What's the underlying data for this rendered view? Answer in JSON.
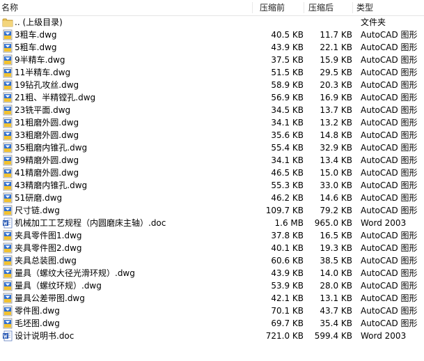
{
  "columns": {
    "name": "名称",
    "compressed": "压缩前",
    "original": "压缩后",
    "type": "类型"
  },
  "files": [
    {
      "icon": "folder-icon",
      "name": ".. (上级目录)",
      "compressed": "",
      "original": "",
      "type": "文件夹"
    },
    {
      "icon": "dwg-file-icon",
      "name": "3粗车.dwg",
      "compressed": "40.5 KB",
      "original": "11.7 KB",
      "type": "AutoCAD 图形"
    },
    {
      "icon": "dwg-file-icon",
      "name": "5粗车.dwg",
      "compressed": "43.9 KB",
      "original": "22.1 KB",
      "type": "AutoCAD 图形"
    },
    {
      "icon": "dwg-file-icon",
      "name": "9半精车.dwg",
      "compressed": "37.5 KB",
      "original": "15.9 KB",
      "type": "AutoCAD 图形"
    },
    {
      "icon": "dwg-file-icon",
      "name": "11半精车.dwg",
      "compressed": "51.5 KB",
      "original": "29.5 KB",
      "type": "AutoCAD 图形"
    },
    {
      "icon": "dwg-file-icon",
      "name": "19钻孔攻丝.dwg",
      "compressed": "58.9 KB",
      "original": "20.3 KB",
      "type": "AutoCAD 图形"
    },
    {
      "icon": "dwg-file-icon",
      "name": "21粗、半精镗孔.dwg",
      "compressed": "56.9 KB",
      "original": "16.9 KB",
      "type": "AutoCAD 图形"
    },
    {
      "icon": "dwg-file-icon",
      "name": "23铣平面.dwg",
      "compressed": "34.5 KB",
      "original": "13.7 KB",
      "type": "AutoCAD 图形"
    },
    {
      "icon": "dwg-file-icon",
      "name": "31粗磨外圆.dwg",
      "compressed": "34.1 KB",
      "original": "13.2 KB",
      "type": "AutoCAD 图形"
    },
    {
      "icon": "dwg-file-icon",
      "name": "33粗磨外圆.dwg",
      "compressed": "35.6 KB",
      "original": "14.8 KB",
      "type": "AutoCAD 图形"
    },
    {
      "icon": "dwg-file-icon",
      "name": "35粗磨内锥孔.dwg",
      "compressed": "55.4 KB",
      "original": "32.9 KB",
      "type": "AutoCAD 图形"
    },
    {
      "icon": "dwg-file-icon",
      "name": "39精磨外圆.dwg",
      "compressed": "34.1 KB",
      "original": "13.4 KB",
      "type": "AutoCAD 图形"
    },
    {
      "icon": "dwg-file-icon",
      "name": "41精磨外圆.dwg",
      "compressed": "46.5 KB",
      "original": "15.0 KB",
      "type": "AutoCAD 图形"
    },
    {
      "icon": "dwg-file-icon",
      "name": "43精磨内锥孔.dwg",
      "compressed": "55.3 KB",
      "original": "33.0 KB",
      "type": "AutoCAD 图形"
    },
    {
      "icon": "dwg-file-icon",
      "name": "51研磨.dwg",
      "compressed": "46.2 KB",
      "original": "14.6 KB",
      "type": "AutoCAD 图形"
    },
    {
      "icon": "dwg-file-icon",
      "name": "尺寸链.dwg",
      "compressed": "109.7 KB",
      "original": "79.2 KB",
      "type": "AutoCAD 图形"
    },
    {
      "icon": "word-doc-icon",
      "name": "机械加工工艺规程（内圆磨床主轴）.doc",
      "compressed": "1.6 MB",
      "original": "965.0 KB",
      "type": "Word 2003"
    },
    {
      "icon": "dwg-file-icon",
      "name": "夹具零件图1.dwg",
      "compressed": "37.8 KB",
      "original": "16.5 KB",
      "type": "AutoCAD 图形"
    },
    {
      "icon": "dwg-file-icon",
      "name": "夹具零件图2.dwg",
      "compressed": "40.1 KB",
      "original": "19.3 KB",
      "type": "AutoCAD 图形"
    },
    {
      "icon": "dwg-file-icon",
      "name": "夹具总装图.dwg",
      "compressed": "60.6 KB",
      "original": "38.5 KB",
      "type": "AutoCAD 图形"
    },
    {
      "icon": "dwg-file-icon",
      "name": "量具（螺纹大径光滑环规）.dwg",
      "compressed": "43.9 KB",
      "original": "14.0 KB",
      "type": "AutoCAD 图形"
    },
    {
      "icon": "dwg-file-icon",
      "name": "量具（螺纹环规）.dwg",
      "compressed": "53.9 KB",
      "original": "28.0 KB",
      "type": "AutoCAD 图形"
    },
    {
      "icon": "dwg-file-icon",
      "name": "量具公差带图.dwg",
      "compressed": "42.1 KB",
      "original": "13.1 KB",
      "type": "AutoCAD 图形"
    },
    {
      "icon": "dwg-file-icon",
      "name": "零件图.dwg",
      "compressed": "70.1 KB",
      "original": "43.7 KB",
      "type": "AutoCAD 图形"
    },
    {
      "icon": "dwg-file-icon",
      "name": "毛坯图.dwg",
      "compressed": "69.7 KB",
      "original": "35.4 KB",
      "type": "AutoCAD 图形"
    },
    {
      "icon": "word-doc-icon",
      "name": "设计说明书.doc",
      "compressed": "721.0 KB",
      "original": "599.4 KB",
      "type": "Word 2003"
    }
  ]
}
